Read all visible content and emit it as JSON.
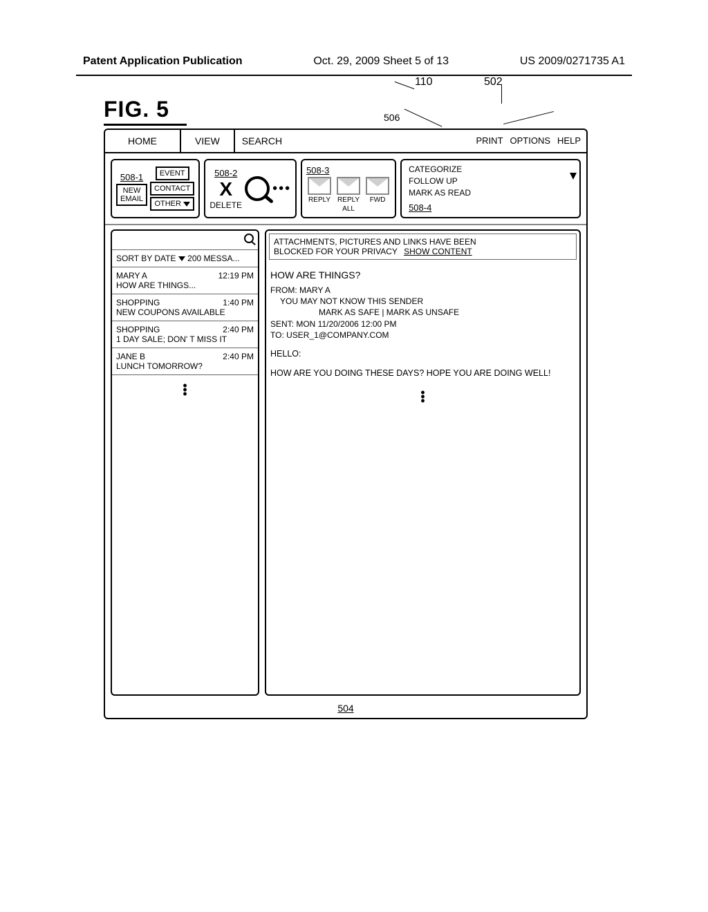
{
  "header": {
    "left": "Patent Application Publication",
    "center": "Oct. 29, 2009  Sheet 5 of 13",
    "right": "US 2009/0271735 A1"
  },
  "figure": {
    "label": "FIG. 5",
    "refs": {
      "r110": "110",
      "r502": "502",
      "r504": "504",
      "r506": "506",
      "r508_1": "508-1",
      "r508_2": "508-2",
      "r508_3": "508-3",
      "r508_4": "508-4"
    }
  },
  "menubar": {
    "home": "HOME",
    "view": "VIEW",
    "search": "SEARCH",
    "print": "PRINT",
    "options": "OPTIONS",
    "help": "HELP"
  },
  "toolbar": {
    "new_group": {
      "new_email_line1": "NEW",
      "new_email_line2": "EMAIL",
      "event": "EVENT",
      "contact": "CONTACT",
      "other": "OTHER"
    },
    "delete_group": {
      "delete": "DELETE"
    },
    "response_group": {
      "reply": "REPLY",
      "reply_all_1": "REPLY",
      "reply_all_2": "ALL",
      "fwd": "FWD"
    },
    "flag_group": {
      "categorize": "CATEGORIZE",
      "follow_up": "FOLLOW UP",
      "mark_read": "MARK AS READ"
    }
  },
  "list": {
    "sort_label": "SORT BY DATE",
    "count_label": "200 MESSA...",
    "items": [
      {
        "from": "MARY A",
        "time": "12:19 PM",
        "subject": "HOW ARE THINGS..."
      },
      {
        "from": "SHOPPING",
        "time": "1:40 PM",
        "subject": "NEW COUPONS AVAILABLE"
      },
      {
        "from": "SHOPPING",
        "time": "2:40 PM",
        "subject": "1 DAY SALE; DON'   T MISS IT"
      },
      {
        "from": "JANE B",
        "time": "2:40 PM",
        "subject": "LUNCH TOMORROW?"
      }
    ]
  },
  "preview": {
    "privacy_l1": "ATTACHMENTS, PICTURES AND LINKS HAVE BEEN",
    "privacy_l2": "BLOCKED FOR YOUR PRIVACY",
    "show_content": "SHOW CONTENT",
    "subject": "HOW ARE THINGS?",
    "from_line": "FROM: MARY A",
    "unknown": "YOU MAY NOT KNOW THIS SENDER",
    "mark_line": "MARK AS SAFE | MARK AS UNSAFE",
    "sent": "SENT: MON 11/20/2006 12:00 PM",
    "to": "TO: USER_1@COMPANY.COM",
    "body_l1": "HELLO:",
    "body_l2": "HOW ARE YOU DOING THESE DAYS?  HOPE YOU ARE DOING WELL!"
  }
}
